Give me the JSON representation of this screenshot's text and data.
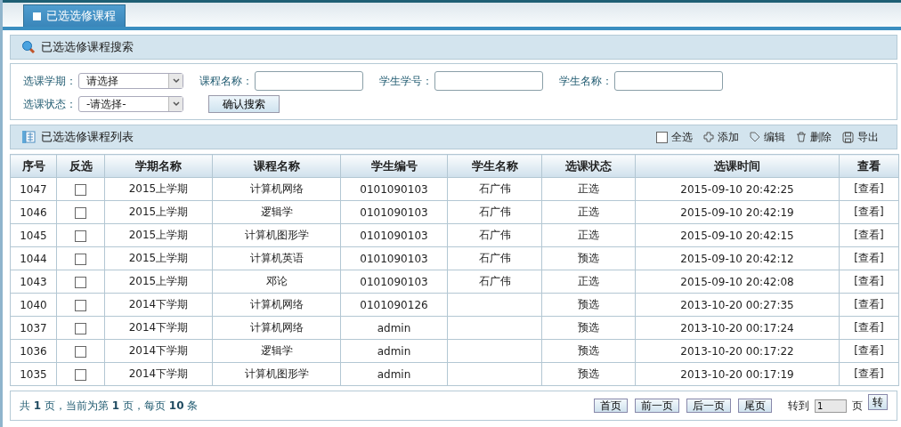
{
  "tab": {
    "label": "已选选修课程",
    "selected": true
  },
  "search_panel": {
    "title": "已选选修课程搜索",
    "fields": [
      {
        "kind": "select",
        "label": "选课学期：",
        "value": "请选择"
      },
      {
        "kind": "text",
        "label": "课程名称："
      },
      {
        "kind": "text",
        "label": "学生学号："
      },
      {
        "kind": "text",
        "label": "学生名称："
      },
      {
        "kind": "select",
        "label": "选课状态：",
        "value": "-请选择-"
      }
    ],
    "search_button": "确认搜索"
  },
  "list_panel": {
    "title": "已选选修课程列表",
    "toolbar": [
      {
        "kind": "checkbox",
        "label": "全选",
        "checked": false
      },
      {
        "kind": "add",
        "label": "添加"
      },
      {
        "kind": "edit",
        "label": "编辑"
      },
      {
        "kind": "delete",
        "label": "删除"
      },
      {
        "kind": "export",
        "label": "导出"
      }
    ]
  },
  "table": {
    "columns": [
      "序号",
      "反选",
      "学期名称",
      "课程名称",
      "学生编号",
      "学生名称",
      "选课状态",
      "选课时间",
      "查看"
    ],
    "rows": [
      {
        "id": "1047",
        "checked": false,
        "term": "2015上学期",
        "course": "计算机网络",
        "student_no": "0101090103",
        "student_name": "石广伟",
        "status": "正选",
        "time": "2015-09-10 20:42:25",
        "action": "[查看]"
      },
      {
        "id": "1046",
        "checked": false,
        "term": "2015上学期",
        "course": "逻辑学",
        "student_no": "0101090103",
        "student_name": "石广伟",
        "status": "正选",
        "time": "2015-09-10 20:42:19",
        "action": "[查看]"
      },
      {
        "id": "1045",
        "checked": false,
        "term": "2015上学期",
        "course": "计算机图形学",
        "student_no": "0101090103",
        "student_name": "石广伟",
        "status": "正选",
        "time": "2015-09-10 20:42:15",
        "action": "[查看]"
      },
      {
        "id": "1044",
        "checked": false,
        "term": "2015上学期",
        "course": "计算机英语",
        "student_no": "0101090103",
        "student_name": "石广伟",
        "status": "预选",
        "time": "2015-09-10 20:42:12",
        "action": "[查看]"
      },
      {
        "id": "1043",
        "checked": false,
        "term": "2015上学期",
        "course": "邓论",
        "student_no": "0101090103",
        "student_name": "石广伟",
        "status": "正选",
        "time": "2015-09-10 20:42:08",
        "action": "[查看]"
      },
      {
        "id": "1040",
        "checked": false,
        "term": "2014下学期",
        "course": "计算机网络",
        "student_no": "0101090126",
        "status": "预选",
        "time": "2013-10-20 00:27:35",
        "action": "[查看]"
      },
      {
        "id": "1037",
        "checked": false,
        "term": "2014下学期",
        "course": "计算机网络",
        "student_no": "admin",
        "status": "预选",
        "time": "2013-10-20 00:17:24",
        "action": "[查看]"
      },
      {
        "id": "1036",
        "checked": false,
        "term": "2014下学期",
        "course": "逻辑学",
        "student_no": "admin",
        "status": "预选",
        "time": "2013-10-20 00:17:22",
        "action": "[查看]"
      },
      {
        "id": "1035",
        "checked": false,
        "term": "2014下学期",
        "course": "计算机图形学",
        "student_no": "admin",
        "status": "预选",
        "time": "2013-10-20 00:17:19",
        "action": "[查看]"
      }
    ]
  },
  "pagination": {
    "summary": "共 **1** 页，当前为第 **1** 页，每页 **10** 条",
    "buttons": [
      "首页",
      "前一页",
      "后一页",
      "尾页"
    ],
    "goto_label": "转到",
    "goto_value": "1",
    "page_unit": "页",
    "go_button": "转"
  }
}
